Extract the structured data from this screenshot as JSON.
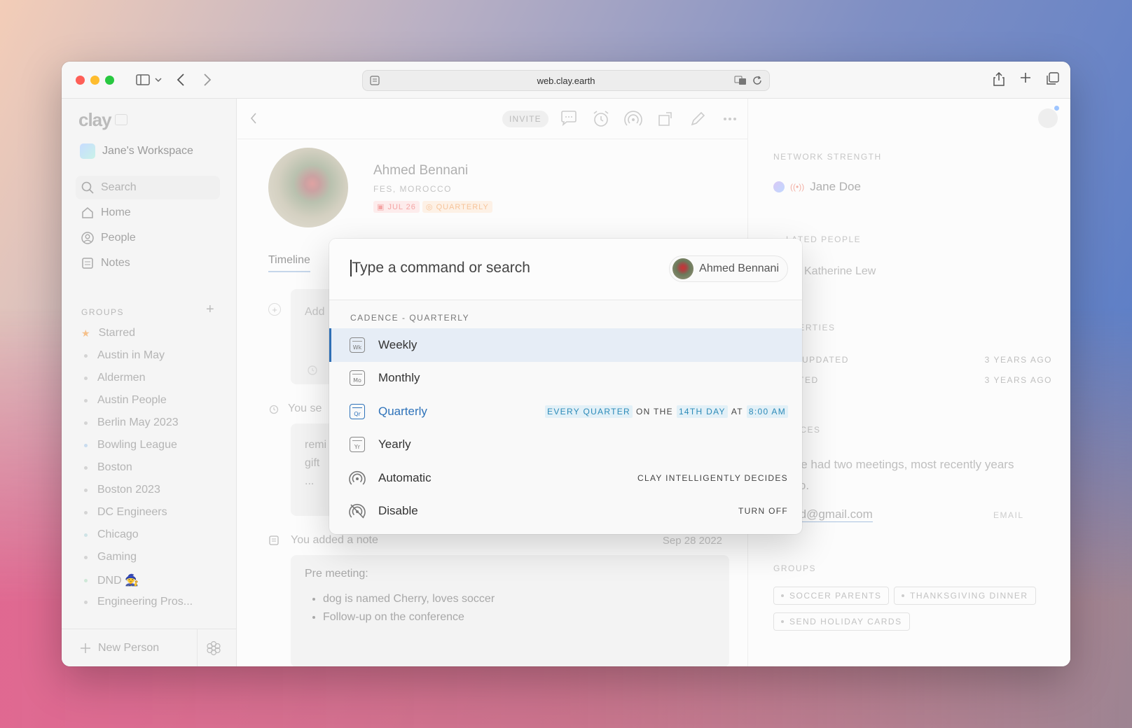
{
  "browser": {
    "url": "web.clay.earth"
  },
  "sidebar": {
    "logo": "clay",
    "workspace": "Jane's Workspace",
    "search_placeholder": "Search",
    "nav": [
      {
        "label": "Home",
        "icon": "home-icon"
      },
      {
        "label": "People",
        "icon": "person-circle-icon"
      },
      {
        "label": "Notes",
        "icon": "notes-icon"
      }
    ],
    "groups_title": "GROUPS",
    "groups": [
      "Starred",
      "Austin in May",
      "Aldermen",
      "Austin People",
      "Berlin May 2023",
      "Bowling League",
      "Boston",
      "Boston 2023",
      "DC Engineers",
      "Chicago",
      "Gaming",
      "DND 🧙",
      "Engineering Pros..."
    ],
    "new_person": "New Person"
  },
  "main": {
    "invite": "INVITE",
    "person": {
      "name": "Ahmed Bennani",
      "location": "FES, MOROCCO",
      "tag_date": "JUL 26",
      "tag_cadence": "QUARTERLY"
    },
    "tab": "Timeline",
    "add_placeholder": "Add",
    "you_set": "You se",
    "remind_lines": [
      "remi",
      "gift",
      "..."
    ],
    "note_event": "You added a note",
    "note_date": "Sep 28 2022",
    "note_title": "Pre meeting:",
    "note_bullets": [
      "dog is named Cherry, loves soccer",
      "Follow-up on the conference"
    ]
  },
  "right_panel": {
    "network_title": "NETWORK STRENGTH",
    "network_person": "Jane Doe",
    "related_title": "LATED PEOPLE",
    "related_person": "Katherine Lew",
    "properties_title": "OPERTIES",
    "properties": [
      {
        "label": "ST UPDATED",
        "value": "3 YEARS AGO"
      },
      {
        "label": "EATED",
        "value": "3 YEARS AGO"
      }
    ],
    "sources_title": "URCES",
    "sources_text": "u've had two meetings, most recently years ago.",
    "email": "med@gmail.com",
    "email_label": "EMAIL",
    "groups_title": "GROUPS",
    "groups": [
      "SOCCER PARENTS",
      "THANKSGIVING DINNER",
      "SEND HOLIDAY CARDS"
    ]
  },
  "palette": {
    "placeholder": "Type a command or search",
    "chip_name": "Ahmed Bennani",
    "section": "CADENCE - QUARTERLY",
    "items": [
      {
        "label": "Weekly",
        "icon": "calendar-week-icon",
        "abbr": "Wk"
      },
      {
        "label": "Monthly",
        "icon": "calendar-month-icon",
        "abbr": "Mo"
      },
      {
        "label": "Quarterly",
        "icon": "calendar-quarter-icon",
        "abbr": "Qr"
      },
      {
        "label": "Yearly",
        "icon": "calendar-year-icon",
        "abbr": "Yr"
      },
      {
        "label": "Automatic",
        "icon": "radar-icon"
      },
      {
        "label": "Disable",
        "icon": "radar-off-icon"
      }
    ],
    "quarterly_detail": {
      "every": "EVERY QUARTER",
      "on_the": "ON THE",
      "day": "14TH DAY",
      "at": "AT",
      "time": "8:00 AM"
    },
    "automatic_detail": "CLAY INTELLIGENTLY DECIDES",
    "disable_detail": "TURN OFF"
  }
}
